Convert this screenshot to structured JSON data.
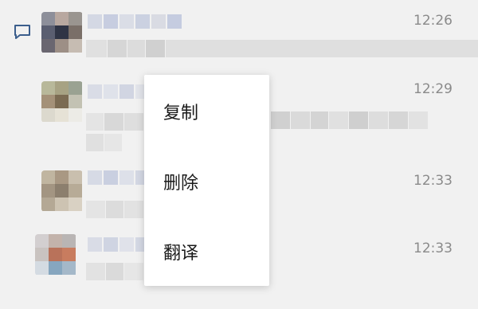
{
  "conversations": [
    {
      "time": "12:26",
      "unread": true
    },
    {
      "time": "12:29",
      "unread": false
    },
    {
      "time": "12:33",
      "unread": false
    },
    {
      "time": "12:33",
      "unread": false
    }
  ],
  "context_menu": {
    "items": [
      {
        "label": "复制"
      },
      {
        "label": "删除"
      },
      {
        "label": "翻译"
      }
    ]
  },
  "icons": {
    "unread": "message-outline-icon"
  },
  "colors": {
    "background": "#f1f1f1",
    "time_text": "#8a8a8a",
    "menu_bg": "#ffffff",
    "menu_text": "#1a1a1a",
    "unread_icon": "#3b5e8c"
  }
}
